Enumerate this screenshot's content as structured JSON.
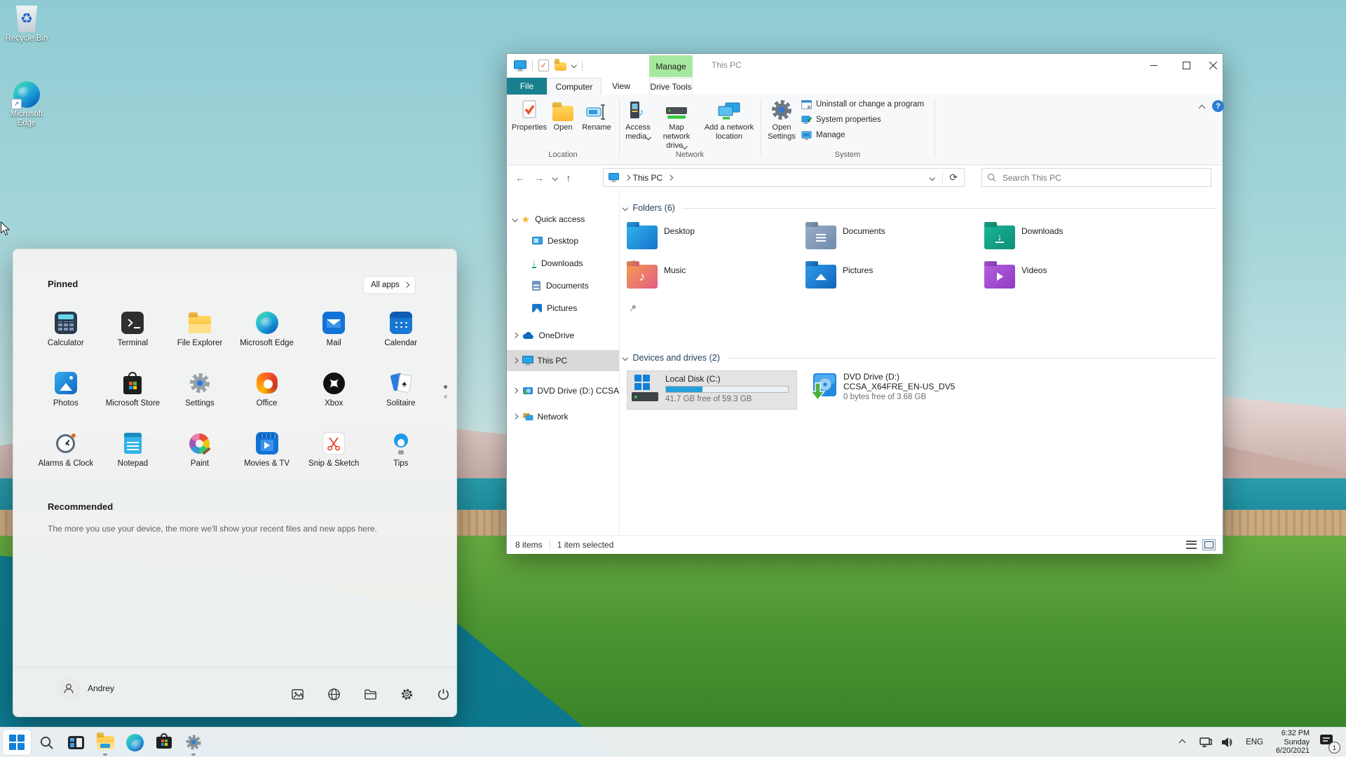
{
  "colors": {
    "accent_teal": "#19808f",
    "manage_green": "#a7e8a0",
    "progress_blue": "#26a0da",
    "nav_selection_gray": "#d9d9d9",
    "taskbar_bg": "#f0f3f6"
  },
  "desktop_icons": {
    "recycle_bin": "Recycle Bin",
    "edge": "Microsoft Edge"
  },
  "explorer": {
    "window_title": "This PC",
    "manage_label": "Manage",
    "tabs": {
      "file": "File",
      "computer": "Computer",
      "view": "View",
      "drive_tools": "Drive Tools"
    },
    "ribbon": {
      "properties": "Properties",
      "open": "Open",
      "rename": "Rename",
      "access_media": "Access media",
      "map_drive": "Map network drive",
      "add_location": "Add a network location",
      "open_settings": "Open Settings",
      "uninstall": "Uninstall or change a program",
      "sys_props": "System properties",
      "manage": "Manage",
      "group_location": "Location",
      "group_network": "Network",
      "group_system": "System"
    },
    "address": {
      "breadcrumb": "This PC",
      "search_placeholder": "Search This PC"
    },
    "nav": {
      "quick_access": "Quick access",
      "desktop": "Desktop",
      "downloads": "Downloads",
      "documents": "Documents",
      "pictures": "Pictures",
      "onedrive": "OneDrive",
      "this_pc": "This PC",
      "dvd": "DVD Drive (D:) CCSA",
      "network": "Network"
    },
    "sections": {
      "folders": "Folders (6)",
      "devices": "Devices and drives (2)"
    },
    "folders": [
      "Desktop",
      "Documents",
      "Downloads",
      "Music",
      "Pictures",
      "Videos"
    ],
    "drives": {
      "local": {
        "name": "Local Disk (C:)",
        "free": "41.7 GB free of 59.3 GB",
        "used_percent": 30
      },
      "dvd": {
        "name": "DVD Drive (D:)",
        "label": "CCSA_X64FRE_EN-US_DV5",
        "free": "0 bytes free of 3.68 GB"
      }
    },
    "statusbar": {
      "count": "8 items",
      "selected": "1 item selected"
    }
  },
  "start_menu": {
    "pinned_label": "Pinned",
    "all_apps_label": "All apps",
    "apps": [
      "Calculator",
      "Terminal",
      "File Explorer",
      "Microsoft Edge",
      "Mail",
      "Calendar",
      "Photos",
      "Microsoft Store",
      "Settings",
      "Office",
      "Xbox",
      "Solitaire",
      "Alarms & Clock",
      "Notepad",
      "Paint",
      "Movies & TV",
      "Snip & Sketch",
      "Tips"
    ],
    "recommended_label": "Recommended",
    "recommended_text": "The more you use your device, the more we'll show your recent files and new apps here.",
    "user_name": "Andrey"
  },
  "tray": {
    "language": "ENG",
    "time": "6:32 PM",
    "day": "Sunday",
    "date": "6/20/2021",
    "notification_count": "1"
  }
}
